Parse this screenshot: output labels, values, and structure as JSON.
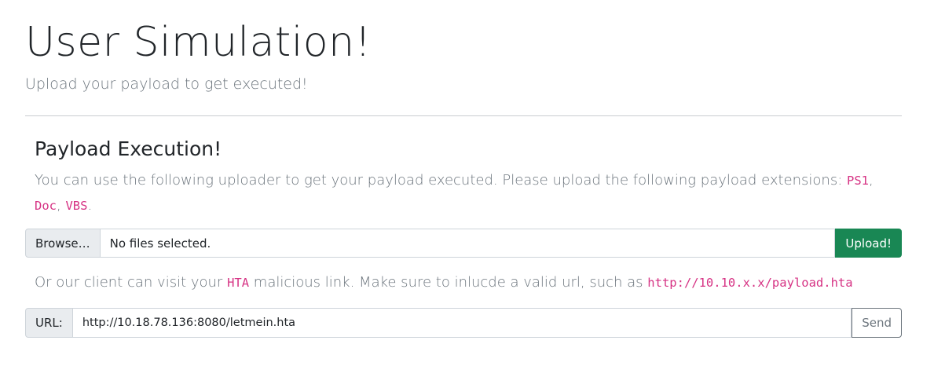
{
  "header": {
    "title": "User Simulation!",
    "subtitle": "Upload your payload to get executed!"
  },
  "payload_section": {
    "title": "Payload Execution!",
    "description_prefix": "You can use the following uploader to get your payload executed. Please upload the following payload extensions: ",
    "extensions": [
      "PS1",
      "Doc",
      "VBS"
    ],
    "separator": ", ",
    "description_suffix": "."
  },
  "file_upload": {
    "browse_label": "Browse…",
    "file_status": "No files selected.",
    "upload_label": "Upload!"
  },
  "hta_note": {
    "prefix": "Or our client can visit your ",
    "hta_code": "HTA",
    "middle": " malicious link. Make sure to inlucde a valid url, such as ",
    "example_url": "http://10.10.x.x/payload.hta"
  },
  "url_form": {
    "label": "URL:",
    "value": "http://10.18.78.136:8080/letmein.hta",
    "send_label": "Send"
  },
  "colors": {
    "code": "#d63384",
    "upload_button": "#198754",
    "muted_text": "#6c757d",
    "addon_background": "#e9ecef"
  }
}
